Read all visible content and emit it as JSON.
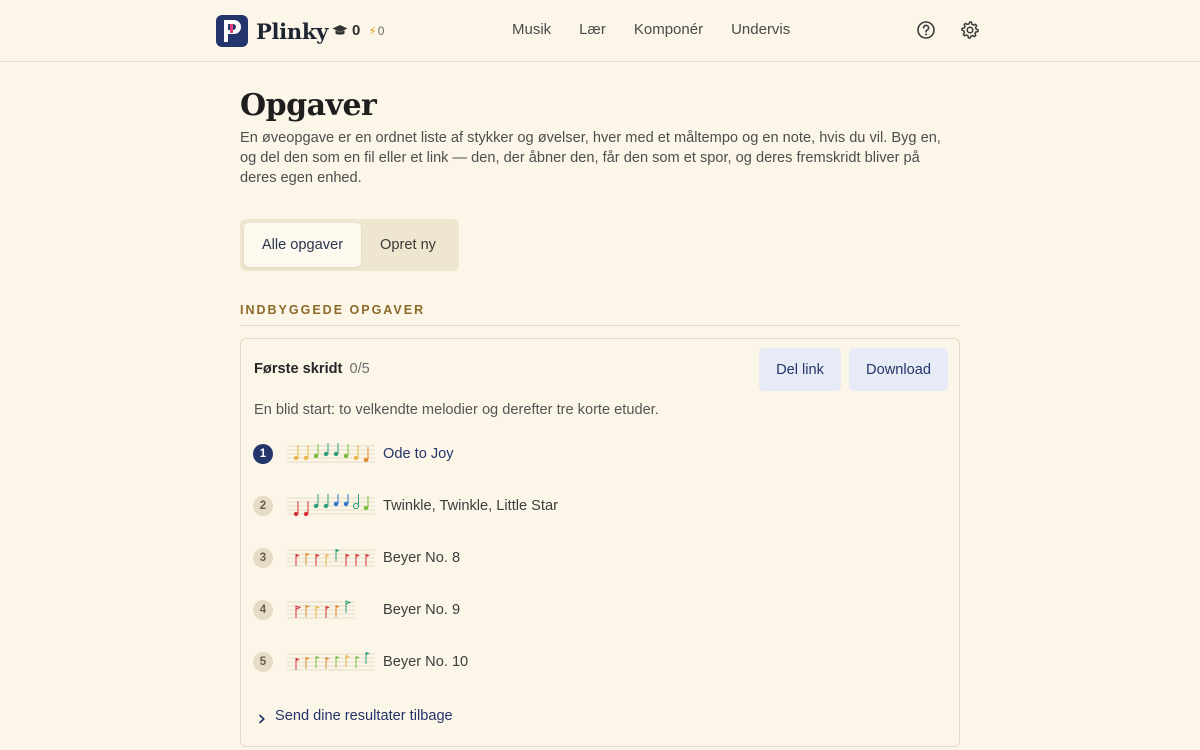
{
  "app": {
    "name": "Plinky",
    "streak": "0",
    "energy": "0"
  },
  "nav": [
    "Musik",
    "Lær",
    "Komponér",
    "Undervis"
  ],
  "page": {
    "title": "Opgaver",
    "intro": "En øveopgave er en ordnet liste af stykker og øvelser, hver med et måltempo og en note, hvis du vil. Byg en, og del den som en fil eller et link — den, der åbner den, får den som et spor, og deres fremskridt bliver på deres egen enhed."
  },
  "tabs": {
    "all": "Alle opgaver",
    "create": "Opret ny"
  },
  "section_label": "INDBYGGEDE OPGAVER",
  "assignment": {
    "title": "Første skridt",
    "progress": "0/5",
    "share_label": "Del link",
    "download_label": "Download",
    "description": "En blid start: to velkendte melodier og derefter tre korte etuder.",
    "items": [
      {
        "num": "1",
        "label": "Ode to Joy",
        "active": true
      },
      {
        "num": "2",
        "label": "Twinkle, Twinkle, Little Star",
        "active": false
      },
      {
        "num": "3",
        "label": "Beyer No. 8",
        "active": false
      },
      {
        "num": "4",
        "label": "Beyer No. 9",
        "active": false
      },
      {
        "num": "5",
        "label": "Beyer No. 10",
        "active": false
      }
    ],
    "send_label": "Send dine resultater tilbage"
  },
  "colors": {
    "accent": "#23356a",
    "background": "#fcf6e9",
    "section_label": "#8b6a2a"
  },
  "icons": [
    "graduation-cap-icon",
    "lightning-icon",
    "help-icon",
    "gear-icon",
    "chevron-right-icon"
  ]
}
